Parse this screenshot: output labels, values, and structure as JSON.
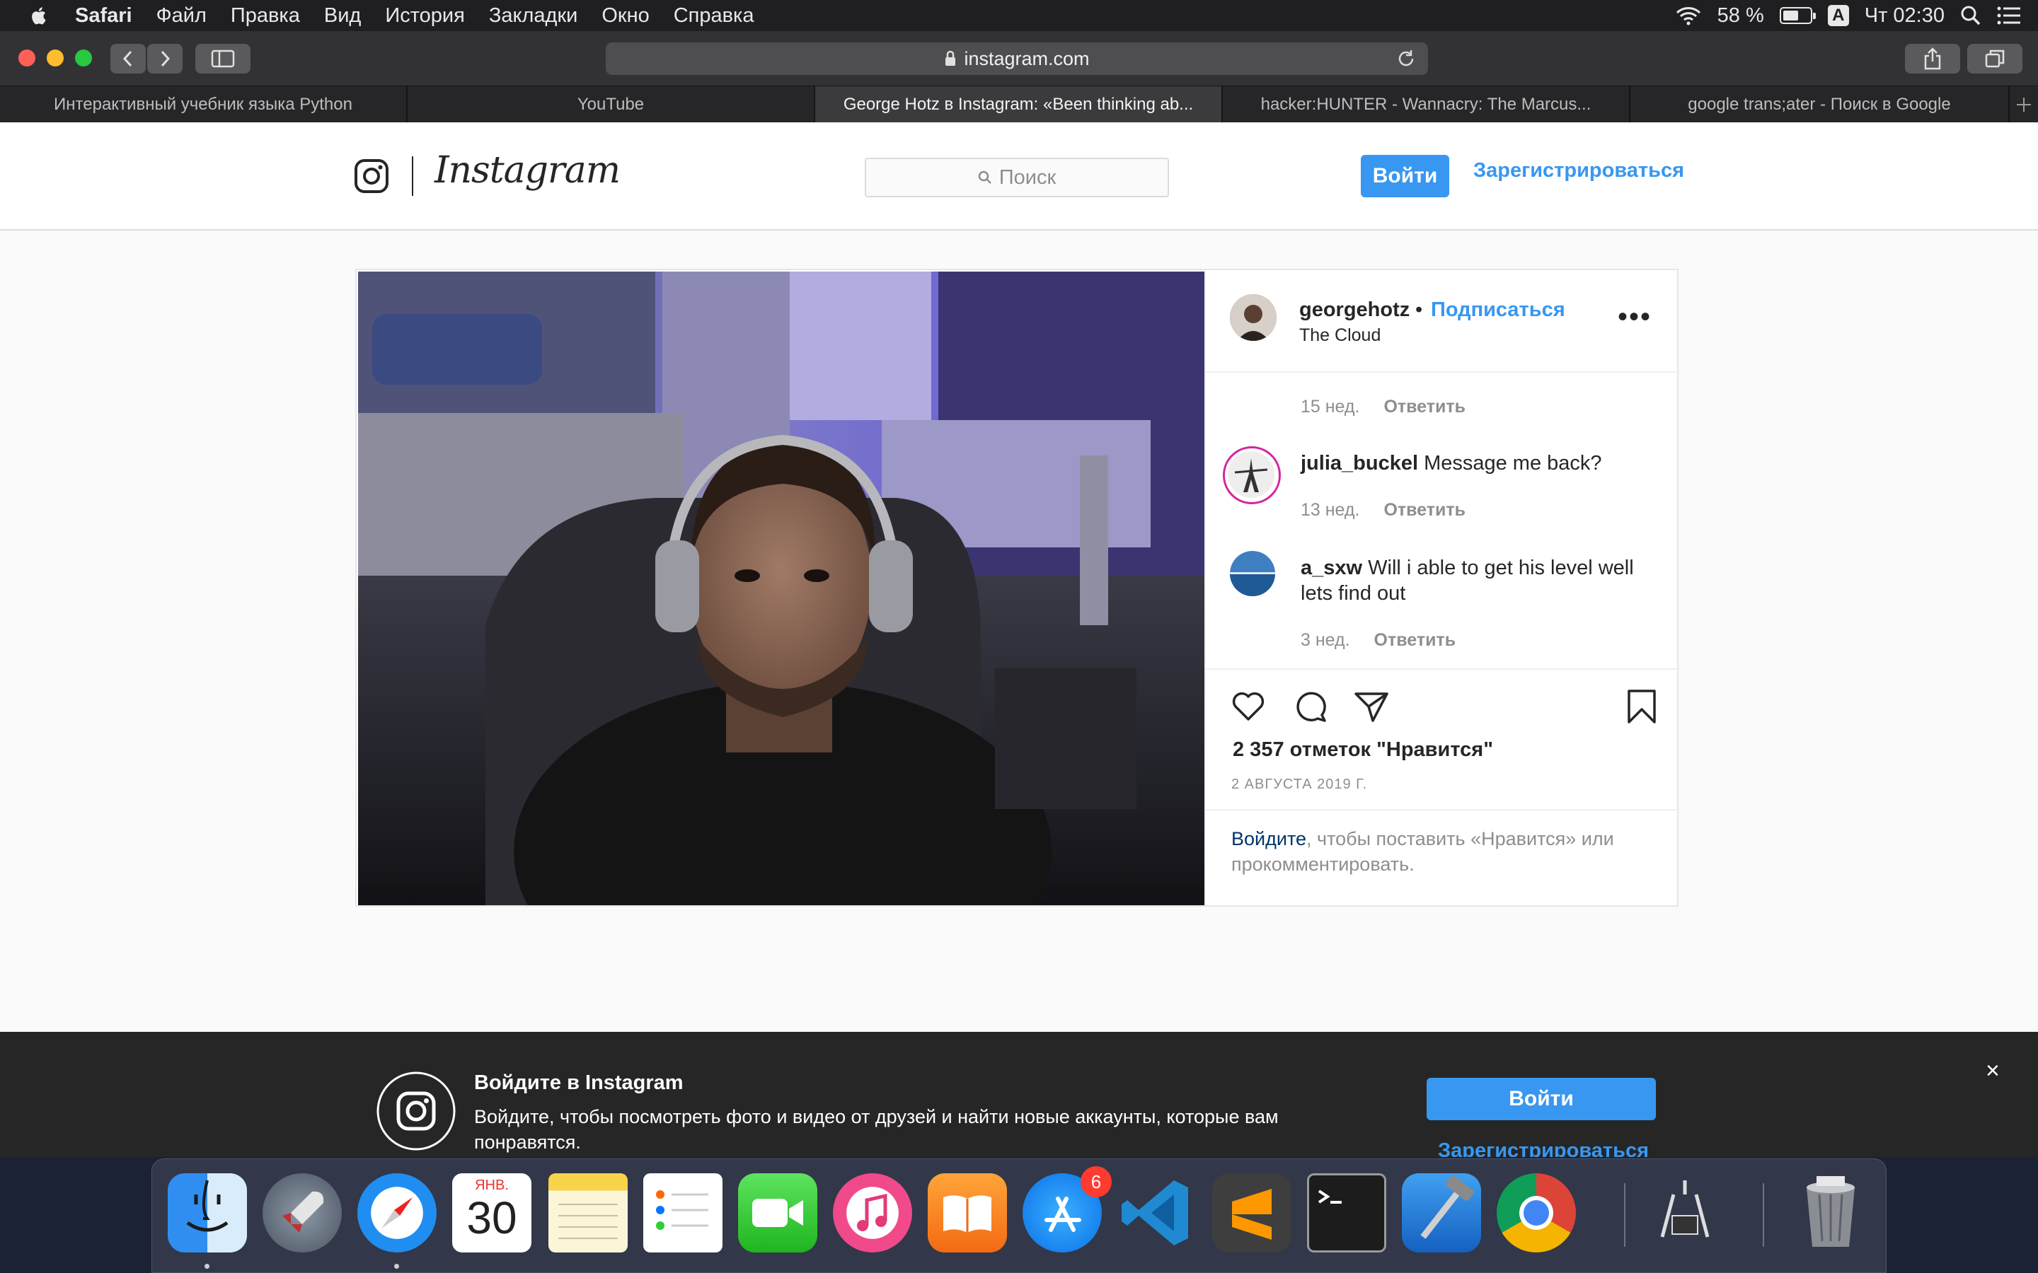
{
  "menubar": {
    "app_name": "Safari",
    "items": [
      "Файл",
      "Правка",
      "Вид",
      "История",
      "Закладки",
      "Окно",
      "Справка"
    ],
    "battery_percent": "58 %",
    "battery_level": 0.58,
    "input_source": "A",
    "clock": "Чт 02:30"
  },
  "browser": {
    "url": "instagram.com",
    "tabs": [
      {
        "title": "Интерактивный учебник языка Python"
      },
      {
        "title": "YouTube"
      },
      {
        "title": "George Hotz в Instagram: «Been thinking ab..."
      },
      {
        "title": "hacker:HUNTER - Wannacry: The Marcus..."
      },
      {
        "title": "google trans;ater - Поиск в Google"
      }
    ],
    "active_tab": 2
  },
  "instagram": {
    "wordmark": "Instagram",
    "search_placeholder": "Поиск",
    "login_label": "Войти",
    "signup_label": "Зарегистрироваться"
  },
  "post": {
    "username": "georgehotz",
    "separator": "•",
    "follow_label": "Подписаться",
    "location": "The Cloud",
    "more_label": "•••",
    "comments": [
      {
        "username": "",
        "text": "",
        "age": "15 нед.",
        "reply_label": "Ответить"
      },
      {
        "username": "julia_buckel",
        "text": "Message me back?",
        "age": "13 нед.",
        "reply_label": "Ответить"
      },
      {
        "username": "a_sxw",
        "text": "Will i able to get his level well lets find out",
        "age": "3 нед.",
        "reply_label": "Ответить"
      }
    ],
    "likes": "2 357 отметок \"Нравится\"",
    "date": "2 АВГУСТА 2019 Г.",
    "login_prompt_link": "Войдите",
    "login_prompt_text": ", чтобы поставить «Нравится» или прокомментировать."
  },
  "banner": {
    "title": "Войдите в Instagram",
    "text": "Войдите, чтобы посмотреть фото и видео от друзей и найти новые аккаунты, которые вам понравятся.",
    "login_label": "Войти",
    "signup_label": "Зарегистрироваться",
    "close_label": "×"
  },
  "dock": {
    "calendar_month": "ЯНВ.",
    "calendar_day": "30",
    "appstore_badge": "6",
    "apps": [
      "finder-icon",
      "launchpad-icon",
      "safari-icon",
      "calendar-icon",
      "notes-icon",
      "reminders-icon",
      "facetime-icon",
      "itunes-icon",
      "books-icon",
      "app-store-icon",
      "vscode-icon",
      "sublime-text-icon",
      "terminal-icon",
      "xcode-icon",
      "chrome-icon",
      "system-information-icon",
      "trash-icon"
    ]
  },
  "colors": {
    "instagram_blue": "#3897f0",
    "menubar_bg": "#1f1f21",
    "toolbar_bg": "#323234",
    "banner_bg": "#262626"
  }
}
